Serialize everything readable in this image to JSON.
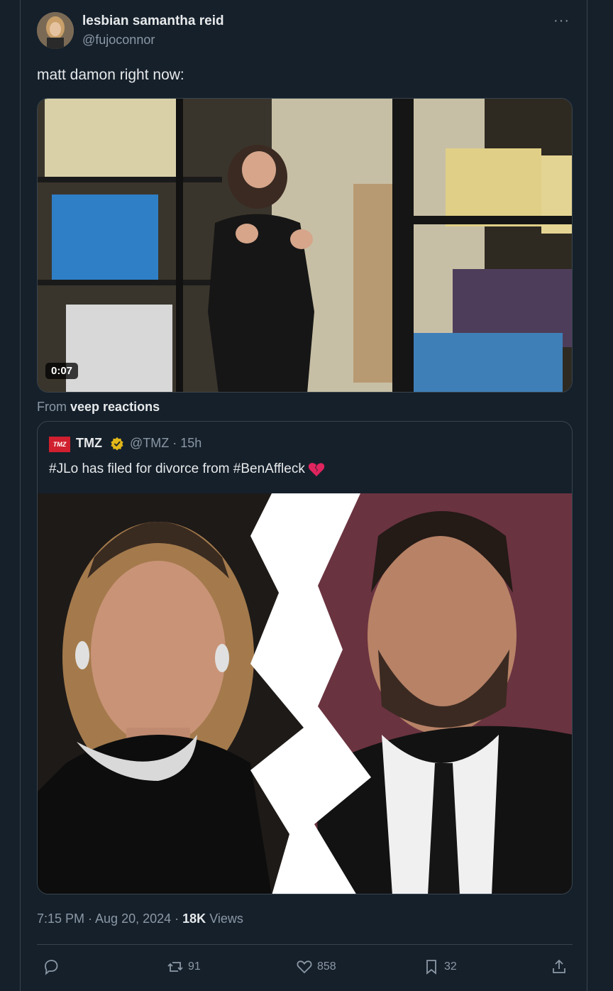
{
  "tweet": {
    "author_name": "lesbian samantha reid",
    "author_handle": "@fujoconnor",
    "text": "matt damon right now:",
    "video_duration": "0:07",
    "from_prefix": "From",
    "from_source": "veep reactions",
    "timestamp": "7:15 PM · Aug 20, 2024 ·",
    "views_count": "18K",
    "views_label": "Views"
  },
  "quote": {
    "logo_text": "TMZ",
    "name": "TMZ",
    "handle_time": "@TMZ · 15h",
    "text": "#JLo has filed for divorce from #BenAffleck"
  },
  "actions": {
    "reposts": "91",
    "likes": "858",
    "bookmarks": "32"
  },
  "colors": {
    "background": "#15202b",
    "border": "#38444d",
    "secondary_text": "#8b98a5",
    "verified_gold": "#e2b719",
    "heart_red": "#e0245e"
  }
}
